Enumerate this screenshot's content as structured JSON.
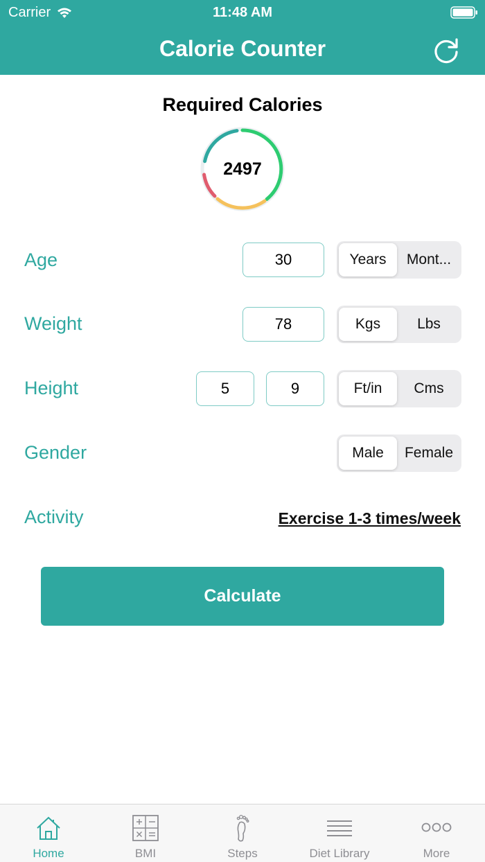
{
  "status": {
    "carrier": "Carrier",
    "time": "11:48 AM"
  },
  "nav": {
    "title": "Calorie Counter"
  },
  "summary": {
    "heading": "Required Calories",
    "value": "2497"
  },
  "form": {
    "age": {
      "label": "Age",
      "value": "30",
      "units": [
        "Years",
        "Mont..."
      ],
      "selected": "Years"
    },
    "weight": {
      "label": "Weight",
      "value": "78",
      "units": [
        "Kgs",
        "Lbs"
      ],
      "selected": "Kgs"
    },
    "height": {
      "label": "Height",
      "feet": "5",
      "inches": "9",
      "units": [
        "Ft/in",
        "Cms"
      ],
      "selected": "Ft/in"
    },
    "gender": {
      "label": "Gender",
      "options": [
        "Male",
        "Female"
      ],
      "selected": "Male"
    },
    "activity": {
      "label": "Activity",
      "value": "Exercise 1-3 times/week"
    }
  },
  "calculate_label": "Calculate",
  "tabs": [
    {
      "label": "Home",
      "icon": "home-icon",
      "active": true
    },
    {
      "label": "BMI",
      "icon": "calculator-icon",
      "active": false
    },
    {
      "label": "Steps",
      "icon": "footprint-icon",
      "active": false
    },
    {
      "label": "Diet Library",
      "icon": "list-icon",
      "active": false
    },
    {
      "label": "More",
      "icon": "more-dots-icon",
      "active": false
    }
  ],
  "colors": {
    "accent": "#2fa8a0",
    "ring_green": "#2ecc71",
    "ring_yellow": "#f5c15c",
    "ring_red": "#e05c6e",
    "ring_teal": "#2fa8a0"
  }
}
